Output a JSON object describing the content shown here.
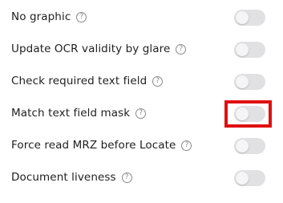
{
  "settings": [
    {
      "label": "No graphic",
      "enabled": false
    },
    {
      "label": "Update OCR validity by glare",
      "enabled": false
    },
    {
      "label": "Check required text field",
      "enabled": false
    },
    {
      "label": "Match text field mask",
      "enabled": false,
      "highlighted": true
    },
    {
      "label": "Force read MRZ before Locate",
      "enabled": false
    },
    {
      "label": "Document liveness",
      "enabled": false
    }
  ],
  "help_glyph": "?",
  "colors": {
    "toggle_off_track": "#e1e1e3",
    "highlight_border": "#e01010",
    "text": "#1f1f1f"
  }
}
